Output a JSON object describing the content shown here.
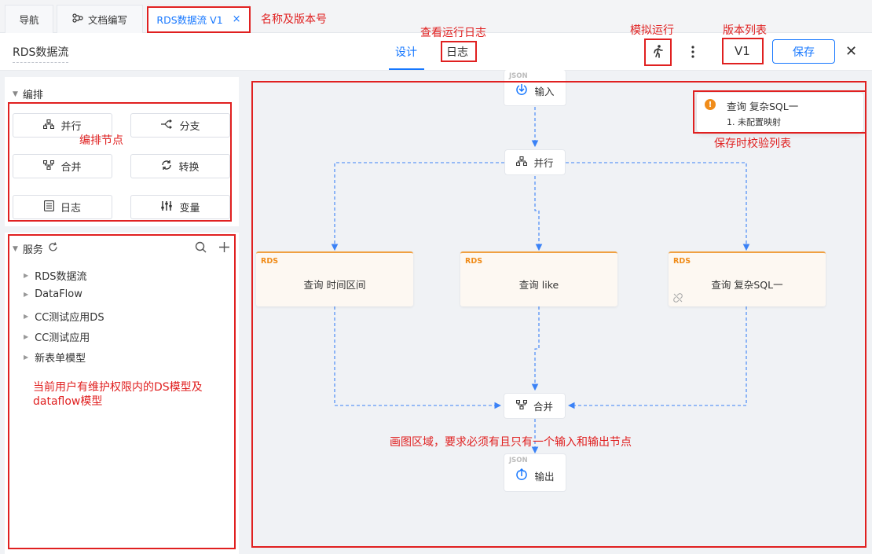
{
  "tabs": [
    {
      "label": "导航"
    },
    {
      "label": "文档编写"
    },
    {
      "label": "RDS数据流 V1",
      "close": "×"
    }
  ],
  "header": {
    "flow_title": "RDS数据流",
    "view_tabs": [
      "设计",
      "日志"
    ],
    "version": "V1",
    "save_label": "保存"
  },
  "orchestration": {
    "title": "编排",
    "nodes": [
      "并行",
      "分支",
      "合并",
      "转换",
      "日志",
      "变量"
    ]
  },
  "services": {
    "title": "服务",
    "items": [
      "RDS数据流",
      "DataFlow",
      "CC测试应用DS",
      "CC测试应用",
      "新表单模型"
    ]
  },
  "canvas": {
    "input_tag": "JSON",
    "input_label": "输入",
    "parallel_label": "并行",
    "merge_label": "合并",
    "output_tag": "JSON",
    "output_label": "输出",
    "rds_cards": [
      {
        "tag": "RDS",
        "name": "查询 时间区间"
      },
      {
        "tag": "RDS",
        "name": "查询 like"
      },
      {
        "tag": "RDS",
        "name": "查询 复杂SQL一"
      }
    ]
  },
  "validation": {
    "title": "查询 复杂SQL一",
    "item": "1. 未配置映射"
  },
  "annotations": {
    "name_version": "名称及版本号",
    "view_log": "查看运行日志",
    "simulate": "模拟运行",
    "version_list": "版本列表",
    "orch_nodes": "编排节点",
    "save_validation": "保存时校验列表",
    "services_note_1": "当前用户有维护权限内的DS模型及",
    "services_note_2": "dataflow模型",
    "canvas_note": "画图区域，要求必须有且只有一个输入和输出节点"
  },
  "colors": {
    "accent": "#1677ff",
    "annotation": "#e02020",
    "rds": "#f08c1a",
    "connector": "#3b82f6"
  }
}
